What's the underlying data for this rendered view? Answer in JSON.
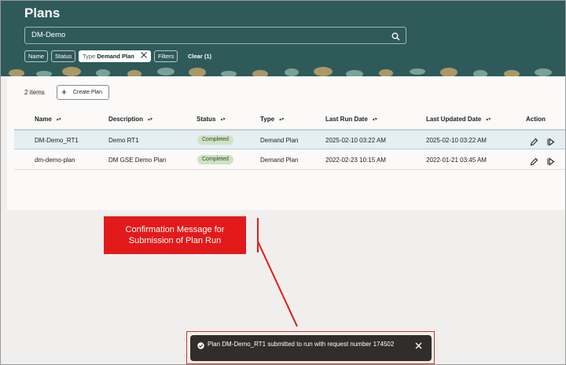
{
  "header": {
    "title": "Plans",
    "search_value": "DM-Demo"
  },
  "filters": {
    "name_label": "Name",
    "status_label": "Status",
    "type_label": "Type",
    "type_value": "Demand Plan",
    "filters_label": "Filters",
    "clear_label": "Clear (1)"
  },
  "toolbar": {
    "count": "2 items",
    "create_label": "Create Plan"
  },
  "table": {
    "columns": [
      "Name",
      "Description",
      "Status",
      "Type",
      "Last Run Date",
      "Last Updated Date",
      "Action"
    ],
    "rows": [
      {
        "name": "DM-Demo_RT1",
        "description": "Demo RT1",
        "status": "Completed",
        "type": "Demand Plan",
        "last_run": "2025-02-10 03:22 AM",
        "last_updated": "2025-02-10 03:22 AM"
      },
      {
        "name": "dm-demo-plan",
        "description": "DM GSE Demo Plan",
        "status": "Completed",
        "type": "Demand Plan",
        "last_run": "2022-02-23 10:15 AM",
        "last_updated": "2022-01-21 03:45 AM"
      }
    ]
  },
  "annotation": {
    "line1": "Confirmation Message for",
    "line2": "Submission of Plan Run"
  },
  "toast": {
    "message": "Plan DM-Demo_RT1 submitted to run with request number 174502"
  },
  "colors": {
    "header_bg": "#2f5a5a",
    "badge_bg": "#cfe3c4",
    "callout_red": "#e31a1a",
    "toast_bg": "#312d2a"
  },
  "icons": [
    "search-icon",
    "close-icon",
    "plus-icon",
    "sort-icon",
    "edit-icon",
    "run-icon",
    "more-icon",
    "check-circle-icon"
  ]
}
